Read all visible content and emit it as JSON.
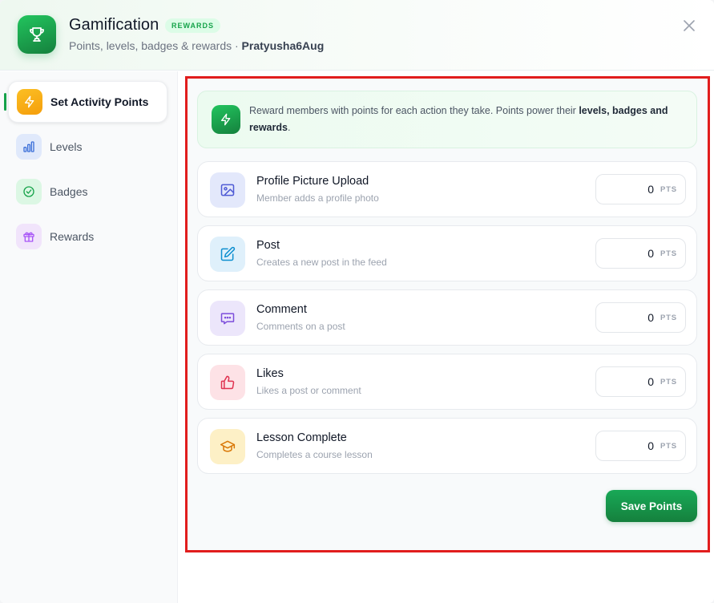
{
  "header": {
    "title": "Gamification",
    "badge": "REWARDS",
    "subtitle": "Points, levels, badges & rewards · ",
    "username": "Pratyusha6Aug",
    "icon": "trophy-icon",
    "close_icon": "close-icon"
  },
  "sidebar": {
    "items": [
      {
        "label": "Set Activity Points",
        "icon": "lightning-icon",
        "active": true
      },
      {
        "label": "Levels",
        "icon": "bar-chart-icon",
        "active": false
      },
      {
        "label": "Badges",
        "icon": "check-circle-icon",
        "active": false
      },
      {
        "label": "Rewards",
        "icon": "gift-icon",
        "active": false
      }
    ]
  },
  "info": {
    "text_prefix": "Reward members with points for each action they take. Points power their ",
    "text_bold": "levels, badges and rewards",
    "text_suffix": ".",
    "icon": "lightning-icon"
  },
  "activities": [
    {
      "title": "Profile Picture Upload",
      "description": "Member adds a profile photo",
      "value": "0",
      "unit": "PTS",
      "icon": "image-icon"
    },
    {
      "title": "Post",
      "description": "Creates a new post in the feed",
      "value": "0",
      "unit": "PTS",
      "icon": "edit-icon"
    },
    {
      "title": "Comment",
      "description": "Comments on a post",
      "value": "0",
      "unit": "PTS",
      "icon": "chat-icon"
    },
    {
      "title": "Likes",
      "description": "Likes a post or comment",
      "value": "0",
      "unit": "PTS",
      "icon": "thumbs-up-icon"
    },
    {
      "title": "Lesson Complete",
      "description": "Completes a course lesson",
      "value": "0",
      "unit": "PTS",
      "icon": "graduation-cap-icon"
    }
  ],
  "actions": {
    "save_label": "Save Points"
  },
  "colors": {
    "accent": "#16a34a",
    "highlight_border": "#e11d1d"
  }
}
